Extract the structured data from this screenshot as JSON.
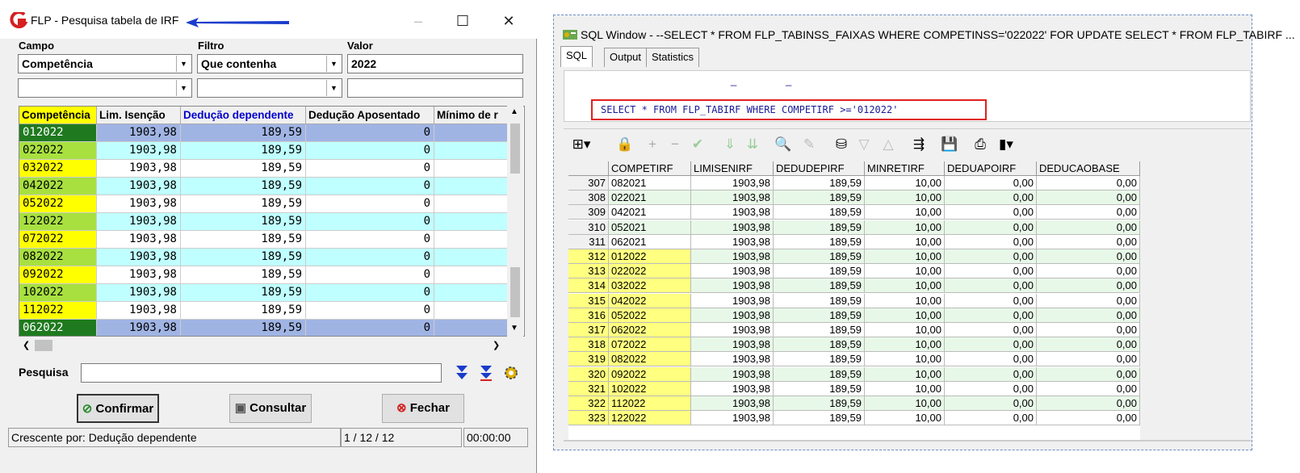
{
  "flp": {
    "title": "FLP - Pesquisa tabela de IRF",
    "labels": {
      "campo": "Campo",
      "filtro": "Filtro",
      "valor": "Valor"
    },
    "campo_value": "Competência",
    "filtro_value": "Que contenha",
    "valor_value": "2022",
    "columns": [
      "Competência",
      "Lim. Isenção",
      "Dedução dependente",
      "Dedução Aposentado",
      "Mínimo de r"
    ],
    "rows": [
      [
        "012022",
        "1903,98",
        "189,59",
        "0",
        ""
      ],
      [
        "022022",
        "1903,98",
        "189,59",
        "0",
        ""
      ],
      [
        "032022",
        "1903,98",
        "189,59",
        "0",
        ""
      ],
      [
        "042022",
        "1903,98",
        "189,59",
        "0",
        ""
      ],
      [
        "052022",
        "1903,98",
        "189,59",
        "0",
        ""
      ],
      [
        "122022",
        "1903,98",
        "189,59",
        "0",
        ""
      ],
      [
        "072022",
        "1903,98",
        "189,59",
        "0",
        ""
      ],
      [
        "082022",
        "1903,98",
        "189,59",
        "0",
        ""
      ],
      [
        "092022",
        "1903,98",
        "189,59",
        "0",
        ""
      ],
      [
        "102022",
        "1903,98",
        "189,59",
        "0",
        ""
      ],
      [
        "112022",
        "1903,98",
        "189,59",
        "0",
        ""
      ],
      [
        "062022",
        "1903,98",
        "189,59",
        "0",
        ""
      ]
    ],
    "pesquisa_label": "Pesquisa",
    "buttons": {
      "confirmar": "Confirmar",
      "consultar": "Consultar",
      "fechar": "Fechar"
    },
    "status": {
      "sort": "Crescente por: Dedução dependente",
      "position": "1 / 12 / 12",
      "time": "00:00:00"
    },
    "colors": {
      "selected_row": "#a0b4e4",
      "cyan_row": "#c0ffff",
      "green_cell": "#a8e040",
      "yellow_cell": "#ffff00",
      "dark_cell": "#1f7a1f",
      "header_yellow": "#ffff00",
      "header_blue_text": "#0000cc"
    }
  },
  "sql": {
    "title": "SQL Window - --SELECT * FROM FLP_TABINSS_FAIXAS WHERE COMPETINSS='022022' FOR UPDATE SELECT * FROM FLP_TABIRF ...",
    "tabs": [
      "SQL",
      "Output",
      "Statistics"
    ],
    "query": "SELECT * FROM FLP_TABIRF WHERE COMPETIRF >='012022'",
    "editor_marks": [
      "_",
      "_"
    ],
    "columns": [
      "COMPETIRF",
      "LIMISENIRF",
      "DEDUDEPIRF",
      "MINRETIRF",
      "DEDUAPOIRF",
      "DEDUCAOBASE"
    ],
    "rows": [
      [
        "307",
        "082021",
        "1903,98",
        "189,59",
        "10,00",
        "0,00",
        "0,00"
      ],
      [
        "308",
        "022021",
        "1903,98",
        "189,59",
        "10,00",
        "0,00",
        "0,00"
      ],
      [
        "309",
        "042021",
        "1903,98",
        "189,59",
        "10,00",
        "0,00",
        "0,00"
      ],
      [
        "310",
        "052021",
        "1903,98",
        "189,59",
        "10,00",
        "0,00",
        "0,00"
      ],
      [
        "311",
        "062021",
        "1903,98",
        "189,59",
        "10,00",
        "0,00",
        "0,00"
      ],
      [
        "312",
        "012022",
        "1903,98",
        "189,59",
        "10,00",
        "0,00",
        "0,00"
      ],
      [
        "313",
        "022022",
        "1903,98",
        "189,59",
        "10,00",
        "0,00",
        "0,00"
      ],
      [
        "314",
        "032022",
        "1903,98",
        "189,59",
        "10,00",
        "0,00",
        "0,00"
      ],
      [
        "315",
        "042022",
        "1903,98",
        "189,59",
        "10,00",
        "0,00",
        "0,00"
      ],
      [
        "316",
        "052022",
        "1903,98",
        "189,59",
        "10,00",
        "0,00",
        "0,00"
      ],
      [
        "317",
        "062022",
        "1903,98",
        "189,59",
        "10,00",
        "0,00",
        "0,00"
      ],
      [
        "318",
        "072022",
        "1903,98",
        "189,59",
        "10,00",
        "0,00",
        "0,00"
      ],
      [
        "319",
        "082022",
        "1903,98",
        "189,59",
        "10,00",
        "0,00",
        "0,00"
      ],
      [
        "320",
        "092022",
        "1903,98",
        "189,59",
        "10,00",
        "0,00",
        "0,00"
      ],
      [
        "321",
        "102022",
        "1903,98",
        "189,59",
        "10,00",
        "0,00",
        "0,00"
      ],
      [
        "322",
        "112022",
        "1903,98",
        "189,59",
        "10,00",
        "0,00",
        "0,00"
      ],
      [
        "323",
        "122022",
        "1903,98",
        "189,59",
        "10,00",
        "0,00",
        "0,00"
      ]
    ],
    "colors": {
      "green_row": "#e8f8e8",
      "highlight_yellow": "#ffff80",
      "query_box": "#e02020",
      "query_text": "#1a1a9a"
    }
  }
}
